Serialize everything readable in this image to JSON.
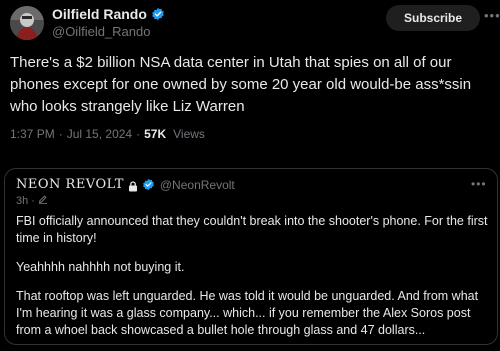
{
  "tweet": {
    "author": {
      "display_name": "Oilfield Rando",
      "handle": "@Oilfield_Rando",
      "verified": true
    },
    "subscribe_label": "Subscribe",
    "more_label": "•••",
    "text": "There's a $2 billion NSA data center in Utah that spies on all of our phones except for one owned by some 20 year old would-be ass*ssin who looks strangely like Liz Warren",
    "time": "1:37 PM",
    "separator": "·",
    "date": "Jul 15, 2024",
    "views_count": "57K",
    "views_label": "Views"
  },
  "quote": {
    "author": {
      "display_name": "NEON REVOLT",
      "handle": "@NeonRevolt",
      "verified": true,
      "locked": true
    },
    "more_label": "•••",
    "age": "3h",
    "separator": "·",
    "paragraphs": [
      "FBI officially announced that they couldn't break into the shooter's phone. For the first time in history!",
      "Yeahhhh nahhhh not buying it.",
      "That rooftop was left unguarded. He was told it would be unguarded. And from what I'm hearing it was a glass company... which... if you remember the Alex Soros post from a whoel back showcased a bullet hole through glass and 47 dollars..."
    ]
  },
  "colors": {
    "background": "#000000",
    "text_primary": "#e7e9ea",
    "text_secondary": "#71767b",
    "verified_blue": "#1d9bf0",
    "border": "#2f3336"
  },
  "icons": [
    "verified-badge-icon",
    "lock-icon",
    "edit-icon",
    "more-icon"
  ]
}
